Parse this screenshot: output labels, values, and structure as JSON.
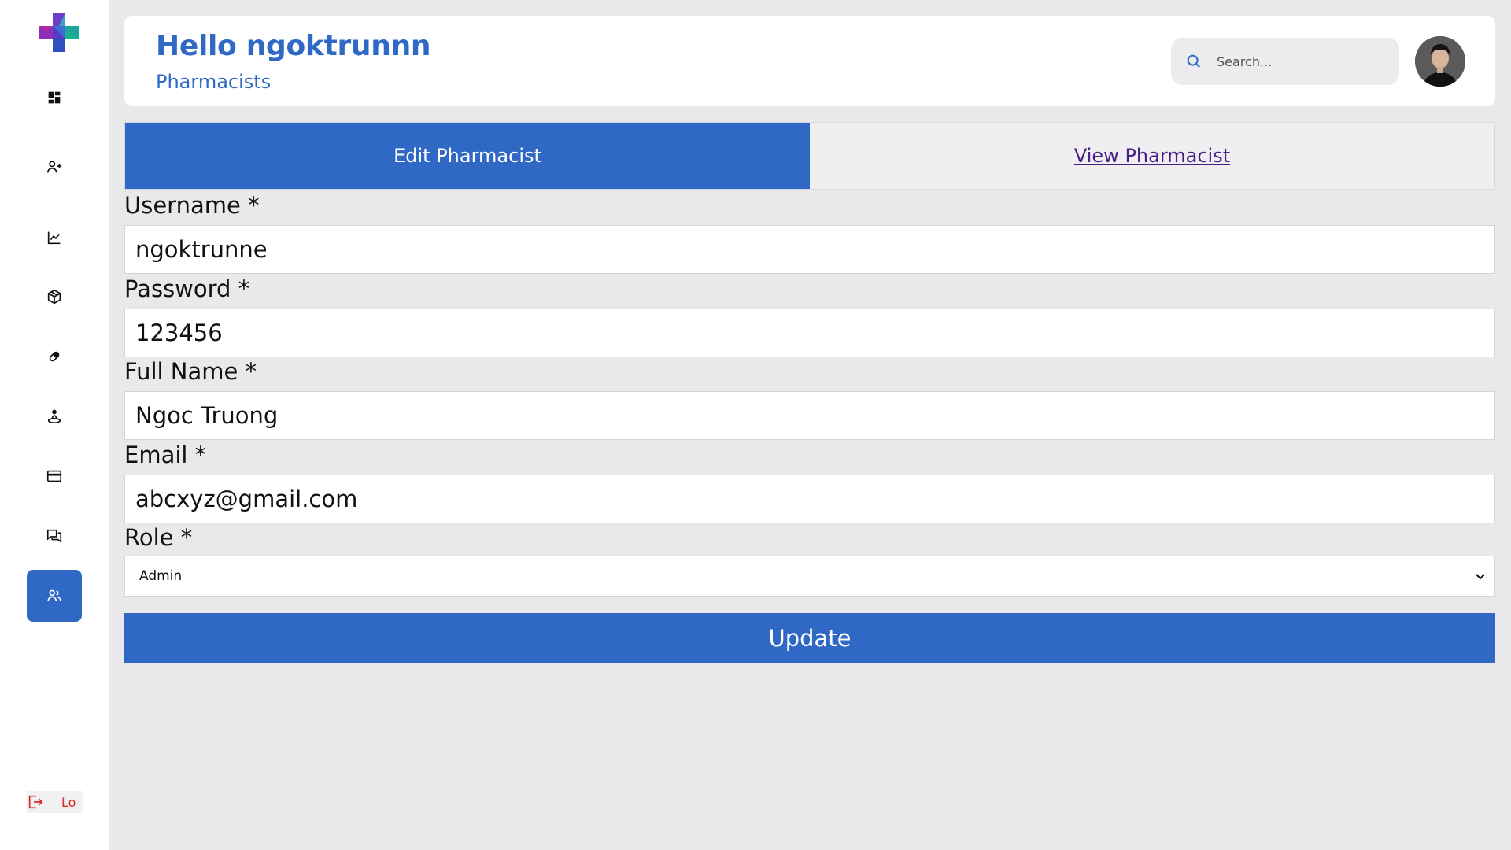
{
  "sidebar": {
    "logo": "app-logo-cross",
    "items": [
      {
        "name": "dashboard",
        "icon": "dashboard-icon"
      },
      {
        "name": "add-user",
        "icon": "user-plus-icon"
      },
      {
        "name": "analytics",
        "icon": "line-chart-icon"
      },
      {
        "name": "inventory",
        "icon": "box-icon"
      },
      {
        "name": "medicine",
        "icon": "pill-icon"
      },
      {
        "name": "supplier",
        "icon": "person-pin-icon"
      },
      {
        "name": "payments",
        "icon": "credit-card-icon"
      },
      {
        "name": "messages",
        "icon": "chat-icon"
      },
      {
        "name": "pharmacists",
        "icon": "users-icon",
        "active": true
      }
    ],
    "logout_label": "Lo"
  },
  "header": {
    "greeting": "Hello ngoktrunnn",
    "subtitle": "Pharmacists",
    "search_placeholder": "Search...",
    "avatar": "user-avatar"
  },
  "tabs": [
    {
      "label": "Edit Pharmacist",
      "active": true
    },
    {
      "label": "View Pharmacist",
      "active": false
    }
  ],
  "form": {
    "username_label": "Username *",
    "username_value": "ngoktrunne",
    "password_label": "Password *",
    "password_value": "123456",
    "fullname_label": "Full Name *",
    "fullname_value": "Ngoc Truong",
    "email_label": "Email *",
    "email_value": "abcxyz@gmail.com",
    "role_label": "Role *",
    "role_value": "Admin",
    "submit_label": "Update"
  },
  "colors": {
    "accent": "#2f68c5",
    "background": "#e9e8ea",
    "logout": "#e02424",
    "link": "#4b1e86"
  }
}
